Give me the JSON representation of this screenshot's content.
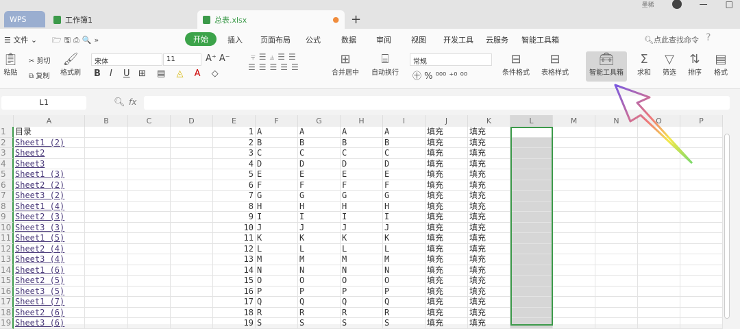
{
  "tabs": {
    "wps": "WPS",
    "workbook1": "工作簿1",
    "active": "总表.xlsx",
    "new_tab": "+"
  },
  "window": {
    "user": "墨稀",
    "minimize": "—",
    "maximize": "□"
  },
  "menu": {
    "file": "文件",
    "items": [
      "开始",
      "插入",
      "页面布局",
      "公式",
      "数据",
      "审阅",
      "视图",
      "开发工具",
      "云服务",
      "智能工具箱"
    ],
    "search": "点此查找命令",
    "help": "?"
  },
  "ribbon": {
    "paste": "粘贴",
    "cut": "剪切",
    "copy": "复制",
    "format_painter": "格式刷",
    "font": "宋体",
    "font_size": "11",
    "bold": "B",
    "italic": "I",
    "underline": "U",
    "merge": "合并居中",
    "wrap": "自动换行",
    "number_format": "常规",
    "percent": "%",
    "cond_format": "条件格式",
    "table_style": "表格样式",
    "smart_toolbox": "智能工具箱",
    "sum": "求和",
    "filter": "筛选",
    "sort": "排序",
    "format": "格式"
  },
  "formula_bar": {
    "name_box": "L1",
    "fx": "fx",
    "value": ""
  },
  "columns": [
    "A",
    "B",
    "C",
    "D",
    "E",
    "F",
    "G",
    "H",
    "I",
    "J",
    "K",
    "L",
    "M",
    "N",
    "O",
    "P"
  ],
  "selected_column": "L",
  "rows": [
    {
      "a": "目录",
      "e": "1",
      "l": "A",
      "j": "填充"
    },
    {
      "a": "Sheet1 (2)",
      "e": "2",
      "l": "B",
      "j": "填充"
    },
    {
      "a": "Sheet2",
      "e": "3",
      "l": "C",
      "j": "填充"
    },
    {
      "a": "Sheet3",
      "e": "4",
      "l": "D",
      "j": "填充"
    },
    {
      "a": "Sheet1 (3)",
      "e": "5",
      "l": "E",
      "j": "填充"
    },
    {
      "a": "Sheet2 (2)",
      "e": "6",
      "l": "F",
      "j": "填充"
    },
    {
      "a": "Sheet3 (2)",
      "e": "7",
      "l": "G",
      "j": "填充"
    },
    {
      "a": "Sheet1 (4)",
      "e": "8",
      "l": "H",
      "j": "填充"
    },
    {
      "a": "Sheet2 (3)",
      "e": "9",
      "l": "I",
      "j": "填充"
    },
    {
      "a": "Sheet3 (3)",
      "e": "10",
      "l": "J",
      "j": "填充"
    },
    {
      "a": "Sheet1 (5)",
      "e": "11",
      "l": "K",
      "j": "填充"
    },
    {
      "a": "Sheet2 (4)",
      "e": "12",
      "l": "L",
      "j": "填充"
    },
    {
      "a": "Sheet3 (4)",
      "e": "13",
      "l": "M",
      "j": "填充"
    },
    {
      "a": "Sheet1 (6)",
      "e": "14",
      "l": "N",
      "j": "填充"
    },
    {
      "a": "Sheet2 (5)",
      "e": "15",
      "l": "O",
      "j": "填充"
    },
    {
      "a": "Sheet3 (5)",
      "e": "16",
      "l": "P",
      "j": "填充"
    },
    {
      "a": "Sheet1 (7)",
      "e": "17",
      "l": "Q",
      "j": "填充"
    },
    {
      "a": "Sheet2 (6)",
      "e": "18",
      "l": "R",
      "j": "填充"
    },
    {
      "a": "Sheet3 (6)",
      "e": "19",
      "l": "S",
      "j": "填充"
    }
  ],
  "colors": {
    "accent": "#3ca34a",
    "link": "#4a3a7a",
    "selection": "#3c9a4a"
  }
}
